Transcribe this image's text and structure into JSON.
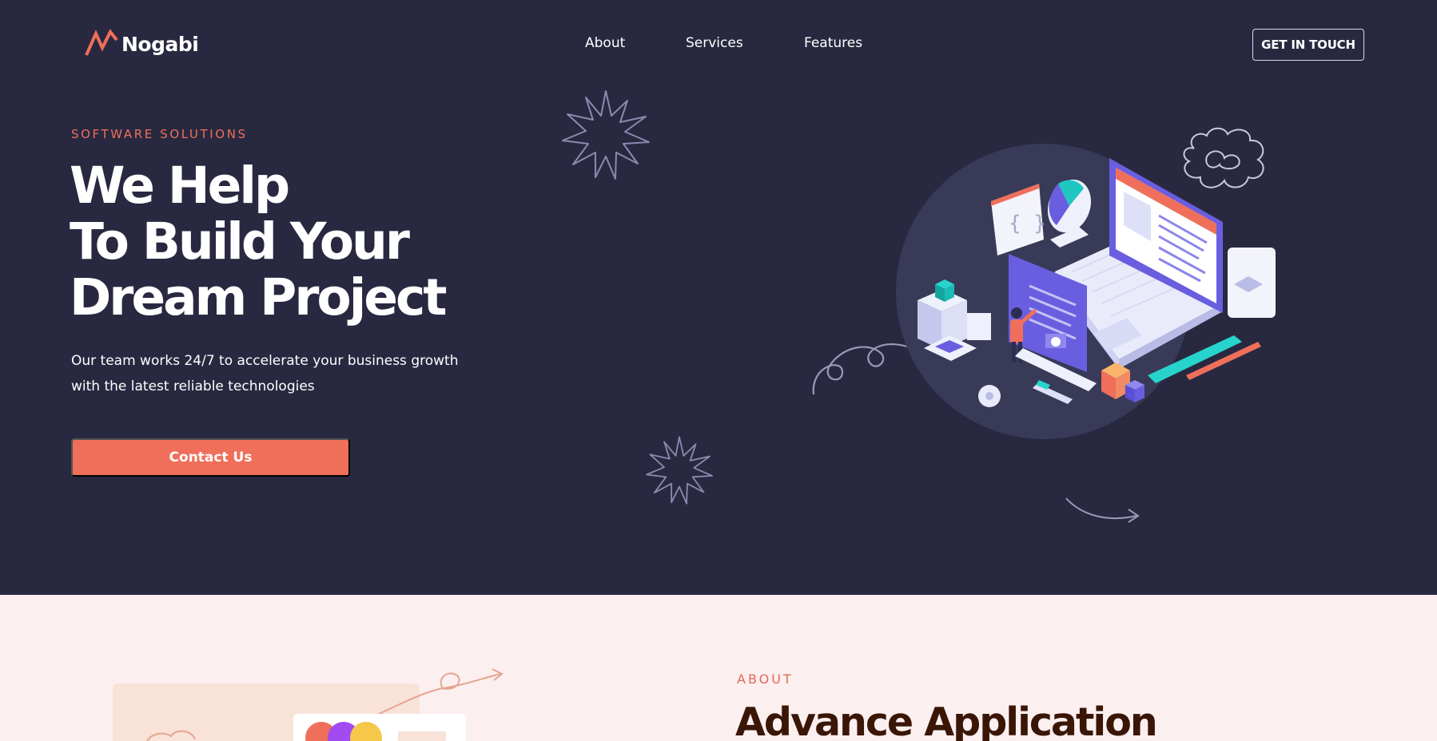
{
  "header": {
    "brand": "Nogabi",
    "nav": [
      "About",
      "Services",
      "Features"
    ],
    "cta": "GET IN TOUCH"
  },
  "hero": {
    "eyebrow": "SOFTWARE SOLUTIONS",
    "headline": [
      "We Help",
      "To Build Your",
      "Dream Project"
    ],
    "subtext": "Our team works 24/7 to accelerate your business growth with the latest reliable technologies",
    "button": "Contact Us"
  },
  "about": {
    "eyebrow": "ABOUT",
    "title": "Advance Application"
  },
  "colors": {
    "hero_bg": "#282940",
    "accent": "#ef6f5a",
    "about_bg": "#fcefef",
    "about_title": "#3a1606"
  }
}
